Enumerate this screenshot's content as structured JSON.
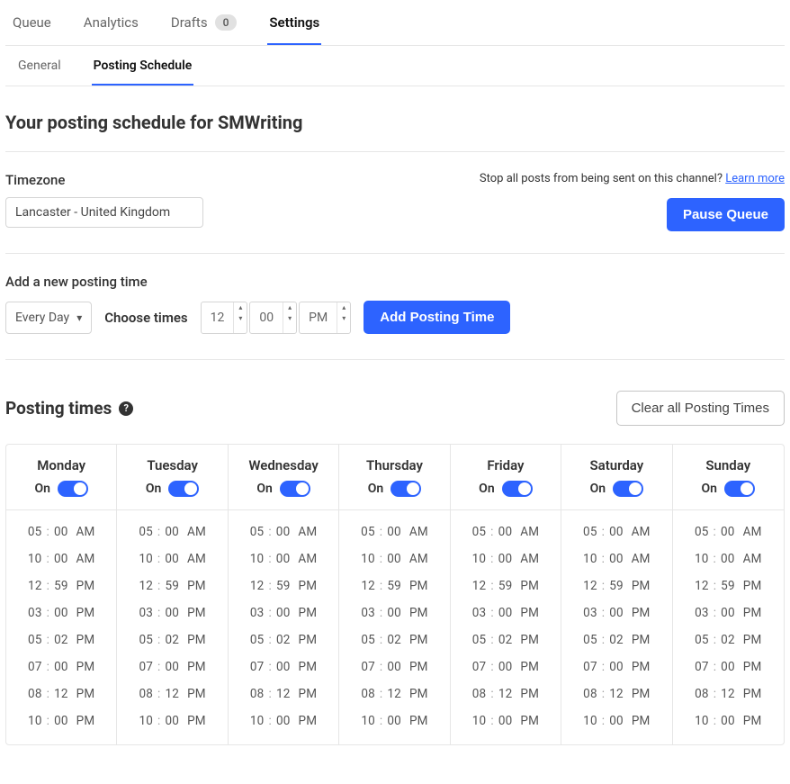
{
  "tabs": {
    "queue": "Queue",
    "analytics": "Analytics",
    "drafts": "Drafts",
    "drafts_count": "0",
    "settings": "Settings"
  },
  "subtabs": {
    "general": "General",
    "posting_schedule": "Posting Schedule"
  },
  "page_title": "Your posting schedule for SMWriting",
  "timezone": {
    "label": "Timezone",
    "value": "Lancaster - United Kingdom"
  },
  "pause": {
    "stop_text": "Stop all posts from being sent on this channel? ",
    "learn_more": "Learn more",
    "button": "Pause Queue"
  },
  "add": {
    "label": "Add a new posting time",
    "every_day": "Every Day",
    "choose_times": "Choose times",
    "hour": "12",
    "minute": "00",
    "ampm": "PM",
    "button": "Add Posting Time"
  },
  "posting_times": {
    "title": "Posting times",
    "clear_all": "Clear all Posting Times",
    "on_label": "On",
    "days": [
      {
        "name": "Monday"
      },
      {
        "name": "Tuesday"
      },
      {
        "name": "Wednesday"
      },
      {
        "name": "Thursday"
      },
      {
        "name": "Friday"
      },
      {
        "name": "Saturday"
      },
      {
        "name": "Sunday"
      }
    ],
    "times": [
      {
        "h": "05",
        "m": "00",
        "p": "AM"
      },
      {
        "h": "10",
        "m": "00",
        "p": "AM"
      },
      {
        "h": "12",
        "m": "59",
        "p": "PM"
      },
      {
        "h": "03",
        "m": "00",
        "p": "PM"
      },
      {
        "h": "05",
        "m": "02",
        "p": "PM"
      },
      {
        "h": "07",
        "m": "00",
        "p": "PM"
      },
      {
        "h": "08",
        "m": "12",
        "p": "PM"
      },
      {
        "h": "10",
        "m": "00",
        "p": "PM"
      }
    ]
  }
}
